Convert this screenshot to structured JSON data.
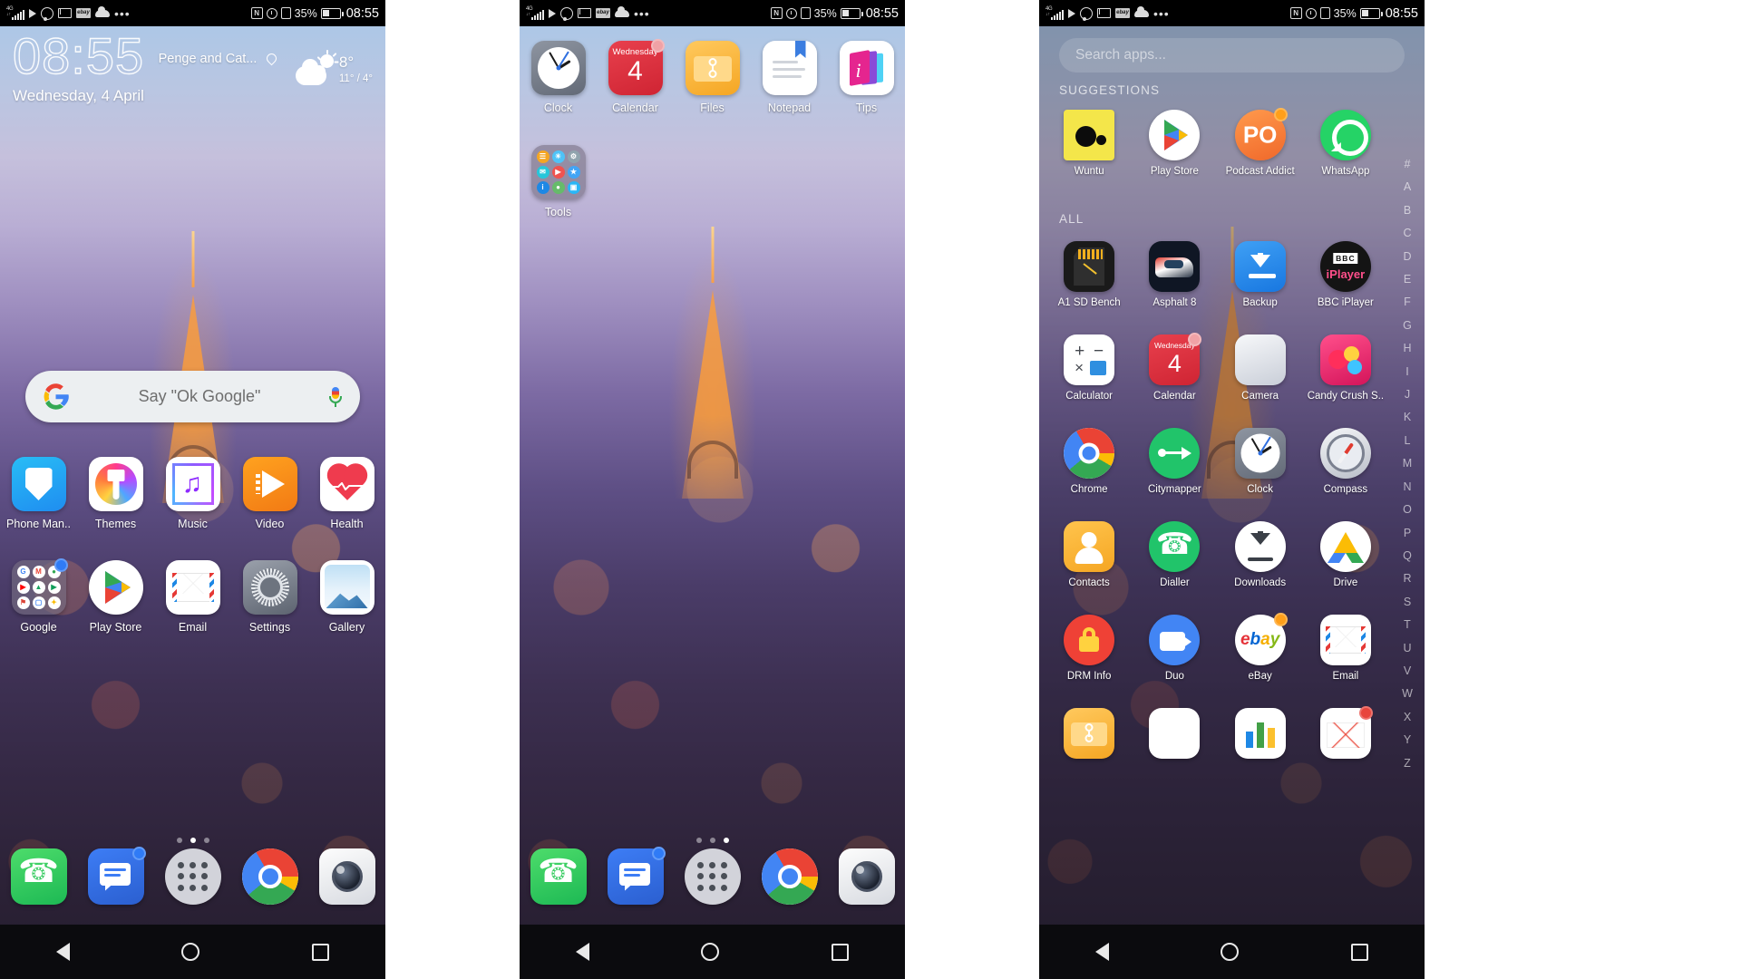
{
  "status_bar": {
    "carrier_network": "4G",
    "icons_left": [
      "signal-bars-icon",
      "play-icon",
      "whatsapp-icon",
      "gmail-icon",
      "ebay-icon",
      "cloud-icon",
      "more-dots-icon"
    ],
    "icons_right": [
      "nfc-icon",
      "alarm-icon",
      "vibrate-icon"
    ],
    "battery_percent": "35%",
    "time": "08:55"
  },
  "screen1": {
    "clock_widget": {
      "time": "08:55",
      "location": "Penge and Cat...",
      "date": "Wednesday, 4 April",
      "weather_icon": "partly-cloudy-icon",
      "temperature": "8°",
      "range": "11° / 4°"
    },
    "search_bar": {
      "placeholder": "Say \"Ok Google\"",
      "logo": "google-g-icon",
      "mic": "microphone-icon"
    },
    "row1": [
      {
        "label": "Phone Man..",
        "icon": "shield-icon"
      },
      {
        "label": "Themes",
        "icon": "paintbrush-icon"
      },
      {
        "label": "Music",
        "icon": "music-note-icon"
      },
      {
        "label": "Video",
        "icon": "play-triangle-icon"
      },
      {
        "label": "Health",
        "icon": "heart-icon"
      }
    ],
    "row2": [
      {
        "label": "Google",
        "icon": "folder-icon",
        "badge": "blue"
      },
      {
        "label": "Play Store",
        "icon": "play-store-icon"
      },
      {
        "label": "Email",
        "icon": "envelope-icon"
      },
      {
        "label": "Settings",
        "icon": "gear-icon"
      },
      {
        "label": "Gallery",
        "icon": "photo-icon"
      }
    ],
    "page_dots": {
      "count": 3,
      "active": 1
    },
    "dock": [
      {
        "label": "",
        "icon": "phone-icon"
      },
      {
        "label": "",
        "icon": "messages-icon",
        "badge": "blue"
      },
      {
        "label": "",
        "icon": "app-drawer-icon"
      },
      {
        "label": "",
        "icon": "chrome-icon"
      },
      {
        "label": "",
        "icon": "camera-icon"
      }
    ]
  },
  "screen2": {
    "row1": [
      {
        "label": "Clock",
        "icon": "analog-clock-icon"
      },
      {
        "label": "Calendar",
        "icon": "calendar-icon",
        "day_name": "Wednesday",
        "day_number": "4",
        "badge": "pink"
      },
      {
        "label": "Files",
        "icon": "files-icon"
      },
      {
        "label": "Notepad",
        "icon": "notepad-icon"
      },
      {
        "label": "Tips",
        "icon": "tips-icon"
      }
    ],
    "row2": [
      {
        "label": "Tools",
        "icon": "folder-icon"
      }
    ],
    "page_dots": {
      "count": 3,
      "active": 2
    },
    "dock": [
      {
        "label": "",
        "icon": "phone-icon"
      },
      {
        "label": "",
        "icon": "messages-icon",
        "badge": "blue"
      },
      {
        "label": "",
        "icon": "app-drawer-icon"
      },
      {
        "label": "",
        "icon": "chrome-icon"
      },
      {
        "label": "",
        "icon": "camera-icon"
      }
    ]
  },
  "screen3": {
    "search": {
      "placeholder": "Search apps..."
    },
    "sections": {
      "suggestions": "SUGGESTIONS",
      "all": "ALL"
    },
    "suggestions": [
      {
        "label": "Wuntu",
        "icon": "wuntu-icon"
      },
      {
        "label": "Play Store",
        "icon": "play-store-icon"
      },
      {
        "label": "Podcast Addict",
        "icon": "podcast-icon",
        "badge": "orange"
      },
      {
        "label": "WhatsApp",
        "icon": "whatsapp-icon"
      }
    ],
    "all_apps": [
      {
        "label": "A1 SD Bench",
        "icon": "sdcard-bench-icon"
      },
      {
        "label": "Asphalt 8",
        "icon": "race-car-icon"
      },
      {
        "label": "Backup",
        "icon": "backup-icon"
      },
      {
        "label": "BBC iPlayer",
        "icon": "bbc-iplayer-icon"
      },
      {
        "label": "Calculator",
        "icon": "calculator-icon"
      },
      {
        "label": "Calendar",
        "icon": "calendar-icon",
        "day_name": "Wednesday",
        "day_number": "4",
        "badge": "pink"
      },
      {
        "label": "Camera",
        "icon": "camera-icon"
      },
      {
        "label": "Candy Crush S..",
        "icon": "candy-crush-icon"
      },
      {
        "label": "Chrome",
        "icon": "chrome-icon"
      },
      {
        "label": "Citymapper",
        "icon": "citymapper-icon"
      },
      {
        "label": "Clock",
        "icon": "analog-clock-icon"
      },
      {
        "label": "Compass",
        "icon": "compass-icon"
      },
      {
        "label": "Contacts",
        "icon": "contacts-icon"
      },
      {
        "label": "Dialler",
        "icon": "dialler-icon"
      },
      {
        "label": "Downloads",
        "icon": "downloads-icon"
      },
      {
        "label": "Drive",
        "icon": "google-drive-icon"
      },
      {
        "label": "DRM Info",
        "icon": "lock-icon"
      },
      {
        "label": "Duo",
        "icon": "duo-video-icon"
      },
      {
        "label": "eBay",
        "icon": "ebay-icon",
        "badge": "orange"
      },
      {
        "label": "Email",
        "icon": "envelope-icon"
      },
      {
        "label": "",
        "icon": "files-icon"
      },
      {
        "label": "",
        "icon": "photo-icon"
      },
      {
        "label": "",
        "icon": "bar-chart-icon"
      },
      {
        "label": "",
        "icon": "gmail-icon",
        "badge": "red"
      }
    ],
    "alpha_index": [
      "#",
      "A",
      "B",
      "C",
      "D",
      "E",
      "F",
      "G",
      "H",
      "I",
      "J",
      "K",
      "L",
      "M",
      "N",
      "O",
      "P",
      "Q",
      "R",
      "S",
      "T",
      "U",
      "V",
      "W",
      "X",
      "Y",
      "Z"
    ]
  },
  "nav_bar": {
    "back": "back-triangle-icon",
    "home": "home-circle-icon",
    "recents": "recents-square-icon"
  },
  "colors": {
    "accent_blue": "#2f7bf6",
    "calendar_red": "#d62b3a",
    "whatsapp_green": "#25d366",
    "wuntu_yellow": "#f4e64a"
  }
}
